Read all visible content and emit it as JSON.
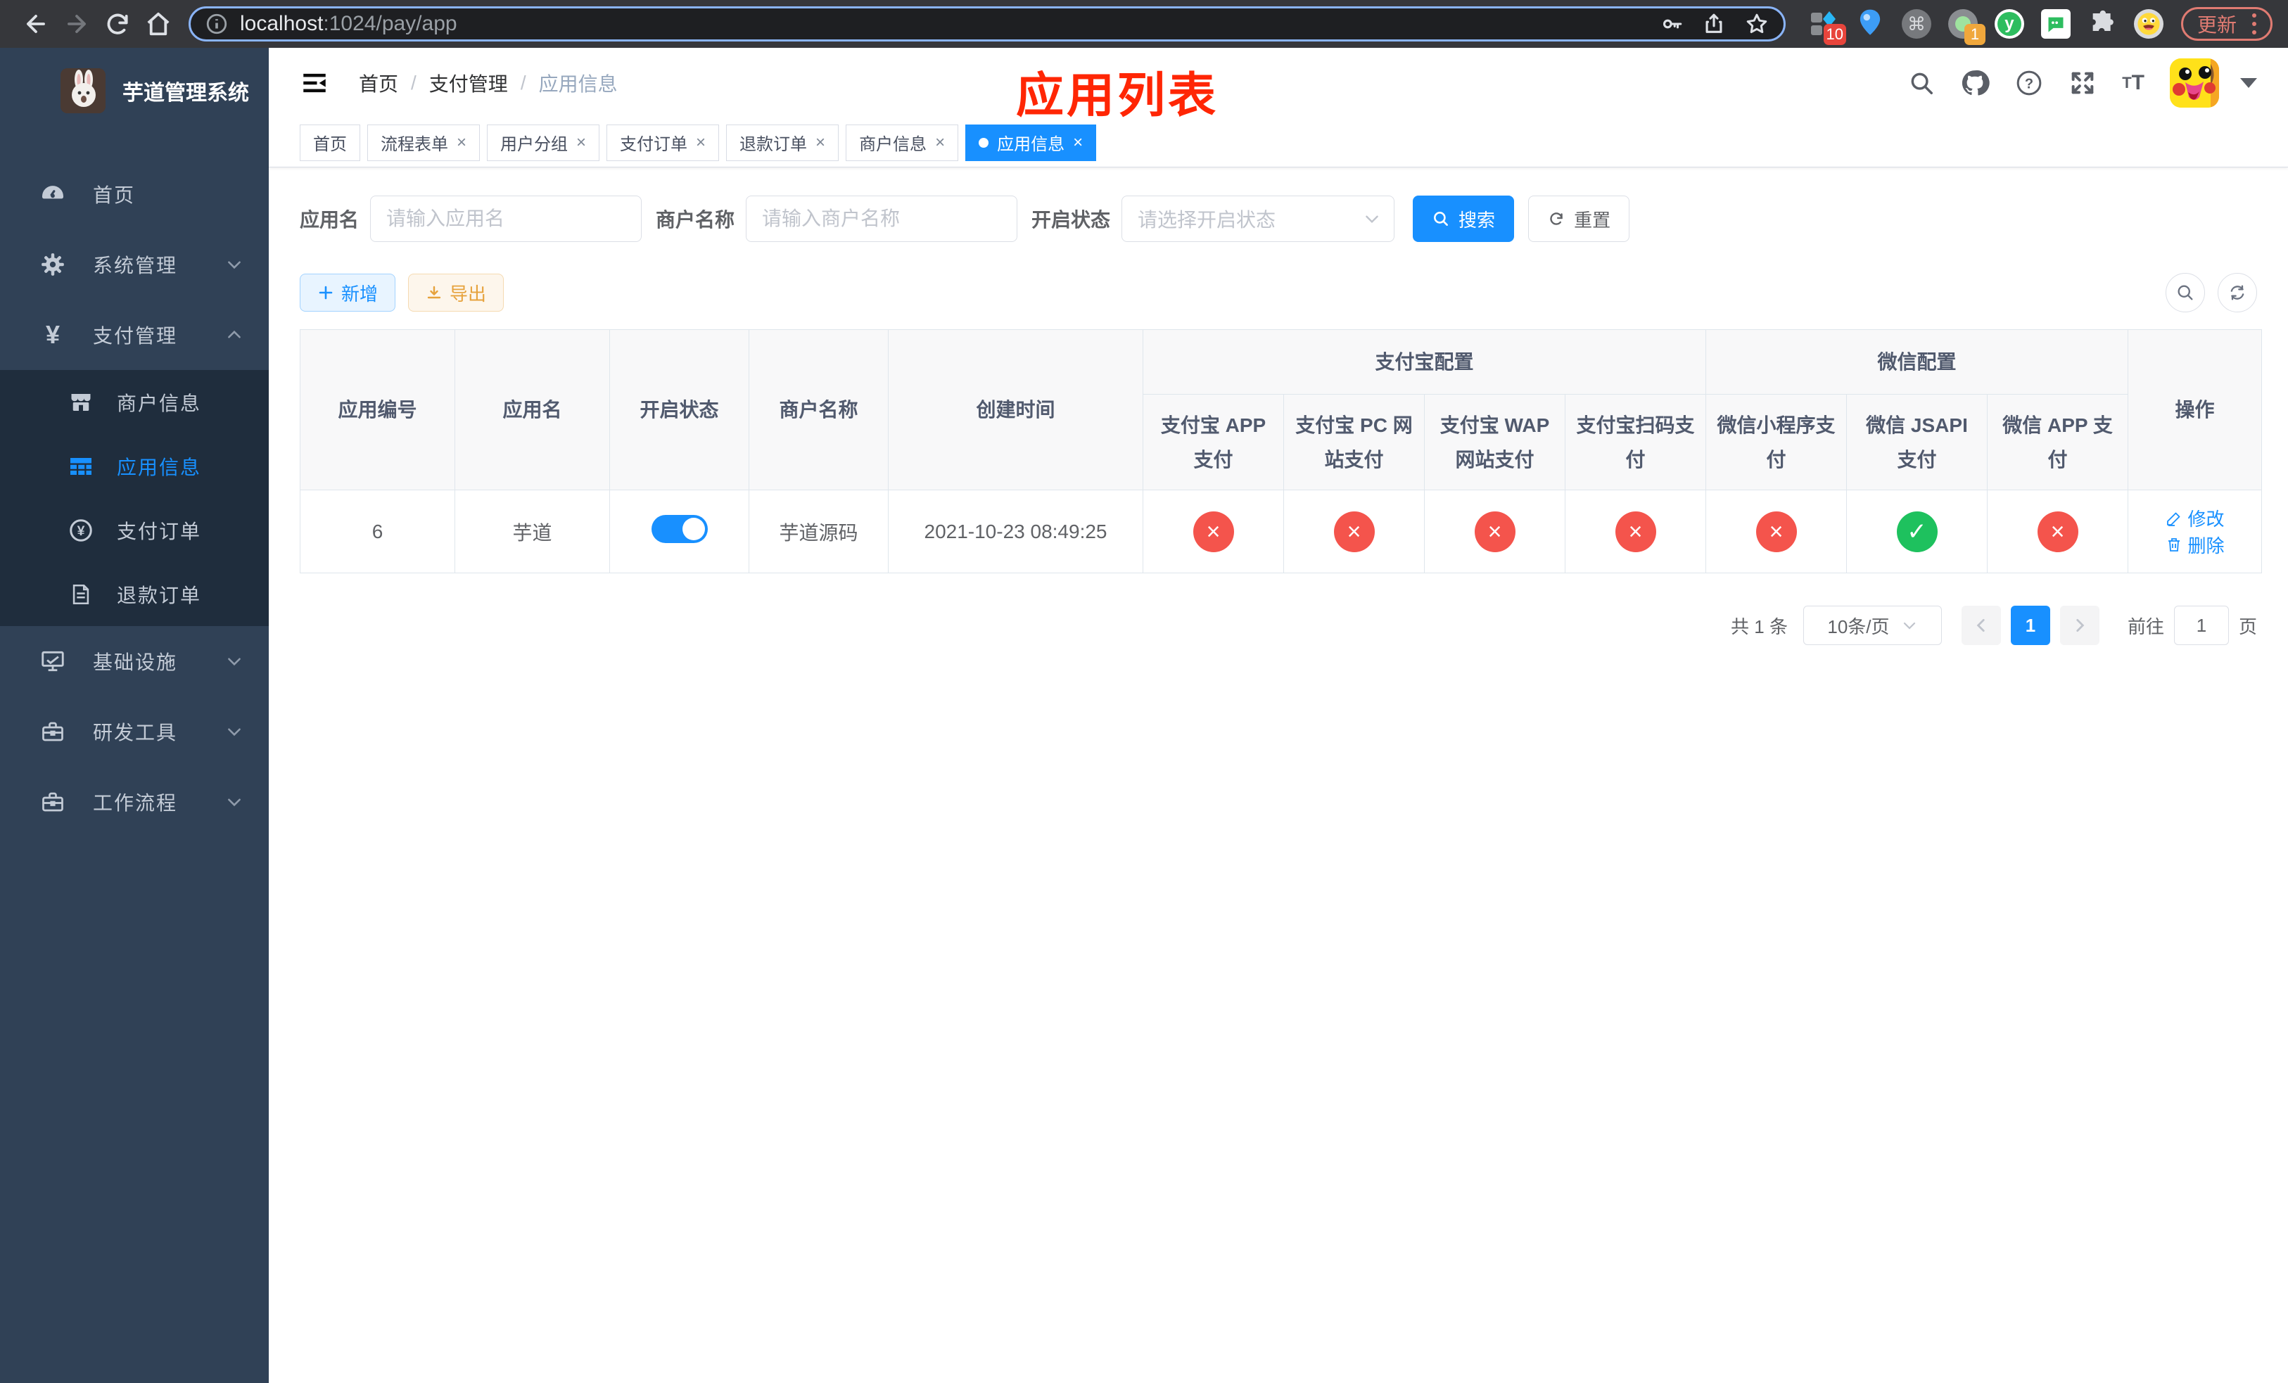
{
  "ui": {
    "close_glyph": "×",
    "breadcrumb_sep": "/",
    "cmd_glyph": "⌘",
    "yen_glyph": "¥",
    "font_size_small": "T",
    "font_size_big": "T"
  },
  "browser": {
    "url_host": "localhost",
    "url_rest": ":1024/pay/app",
    "update_label": "更新",
    "ext_badge_blue": "10",
    "ext_badge_orange": "1"
  },
  "sidebar": {
    "title": "芋道管理系统",
    "items": [
      {
        "label": "首页"
      },
      {
        "label": "系统管理"
      },
      {
        "label": "支付管理"
      },
      {
        "label": "商户信息"
      },
      {
        "label": "应用信息"
      },
      {
        "label": "支付订单"
      },
      {
        "label": "退款订单"
      },
      {
        "label": "基础设施"
      },
      {
        "label": "研发工具"
      },
      {
        "label": "工作流程"
      }
    ]
  },
  "navbar": {
    "breadcrumb": [
      "首页",
      "支付管理",
      "应用信息"
    ],
    "annotation": "应用列表"
  },
  "tabs": [
    {
      "label": "首页"
    },
    {
      "label": "流程表单"
    },
    {
      "label": "用户分组"
    },
    {
      "label": "支付订单"
    },
    {
      "label": "退款订单"
    },
    {
      "label": "商户信息"
    },
    {
      "label": "应用信息"
    }
  ],
  "filters": {
    "app_name_label": "应用名",
    "app_name_placeholder": "请输入应用名",
    "merchant_label": "商户名称",
    "merchant_placeholder": "请输入商户名称",
    "status_label": "开启状态",
    "status_placeholder": "请选择开启状态",
    "search_label": "搜索",
    "reset_label": "重置"
  },
  "toolbar": {
    "add_label": "新增",
    "export_label": "导出"
  },
  "table": {
    "col_app_id": "应用编号",
    "col_app_name": "应用名",
    "col_status": "开启状态",
    "col_merchant": "商户名称",
    "col_created": "创建时间",
    "group_alipay": "支付宝配置",
    "group_wechat": "微信配置",
    "col_actions": "操作",
    "sub_headers": [
      "支付宝 APP 支付",
      "支付宝 PC 网站支付",
      "支付宝 WAP 网站支付",
      "支付宝扫码支付",
      "微信小程序支付",
      "微信 JSAPI 支付",
      "微信 APP 支付"
    ],
    "rows": [
      {
        "app_id": "6",
        "app_name": "芋道",
        "merchant": "芋道源码",
        "created": "2021-10-23 08:49:25",
        "badges": [
          {
            "cls": "badge off",
            "glyph": "×"
          },
          {
            "cls": "badge off",
            "glyph": "×"
          },
          {
            "cls": "badge off",
            "glyph": "×"
          },
          {
            "cls": "badge off",
            "glyph": "×"
          },
          {
            "cls": "badge off",
            "glyph": "×"
          },
          {
            "cls": "badge on",
            "glyph": "✓"
          },
          {
            "cls": "badge off",
            "glyph": "×"
          }
        ],
        "edit_label": "修改",
        "delete_label": "删除"
      }
    ]
  },
  "pagination": {
    "total": "共 1 条",
    "page_size": "10条/页",
    "page": "1",
    "goto_prefix": "前往",
    "goto_value": "1",
    "goto_suffix": "页"
  }
}
